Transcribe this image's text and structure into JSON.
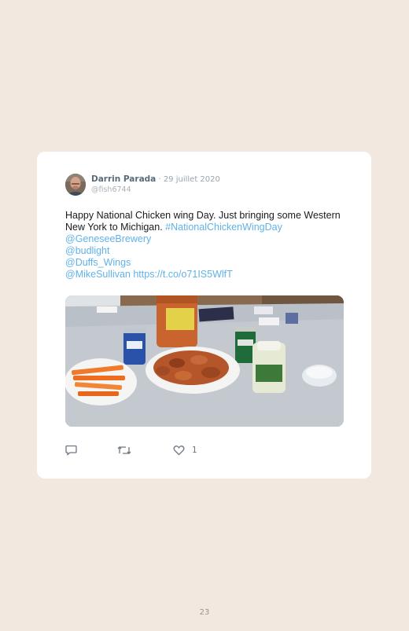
{
  "tweet": {
    "author_name": "Darrin Parada",
    "separator": " · ",
    "date": "29 juillet 2020",
    "handle": "@fish6744",
    "text_plain": "Happy National Chicken wing Day. Just bringing some Western New York to Michigan. ",
    "hashtag": "#NationalChickenWingDay",
    "mentions": [
      "@GeneseeBrewery",
      "@budlight",
      "@Duffs_Wings"
    ],
    "last_mention": "@MikeSullivan",
    "link": "https://t.co/o71IS5WlfT",
    "like_count": "1"
  },
  "icons": {
    "reply": "comment-icon",
    "retweet": "retweet-icon",
    "like": "heart-icon"
  },
  "colors": {
    "page_background": "#f2e8df",
    "card_background": "#ffffff",
    "link": "#5fb2e8",
    "author_name": "#5b6a7a",
    "meta": "#9aa4ae",
    "icon": "#6b7785"
  },
  "footer": {
    "page_number": "23"
  }
}
